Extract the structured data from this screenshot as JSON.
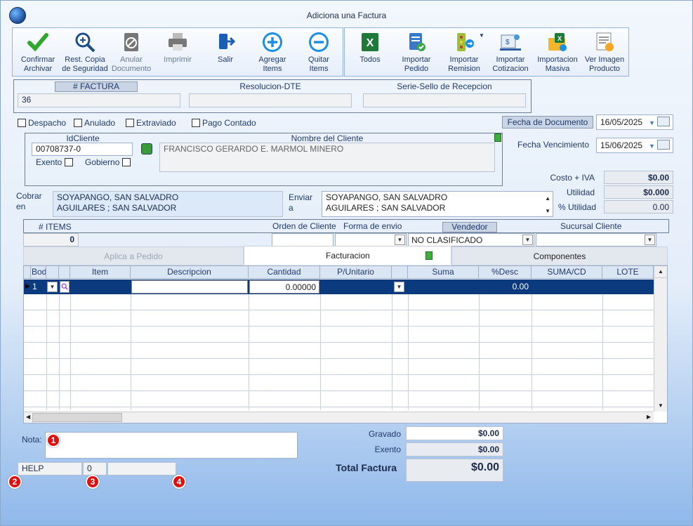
{
  "window": {
    "title": "Adiciona una Factura"
  },
  "toolbar": {
    "left": [
      {
        "label1": "Confirmar",
        "label2": "Archivar"
      },
      {
        "label1": "Rest. Copia",
        "label2": "de Seguridad"
      },
      {
        "label1": "Anular",
        "label2": "Documento"
      },
      {
        "label1": "Imprimir",
        "label2": ""
      },
      {
        "label1": "Salir",
        "label2": ""
      },
      {
        "label1": "Agregar",
        "label2": "Items"
      },
      {
        "label1": "Quitar",
        "label2": "Items"
      }
    ],
    "right": [
      {
        "label1": "Todos",
        "label2": ""
      },
      {
        "label1": "Importar",
        "label2": "Pedido"
      },
      {
        "label1": "Importar",
        "label2": "Remision"
      },
      {
        "label1": "Importar",
        "label2": "Cotizacion"
      },
      {
        "label1": "Importacion",
        "label2": "Masiva"
      },
      {
        "label1": "Ver Imagen",
        "label2": "Producto"
      }
    ]
  },
  "header": {
    "factura_label": "# FACTURA",
    "factura_value": "36",
    "resolucion_label": "Resolucion-DTE",
    "resolucion_value": "",
    "serie_label": "Serie-Sello de Recepcion",
    "serie_value": ""
  },
  "flags": {
    "despacho": "Despacho",
    "anulado": "Anulado",
    "extraviado": "Extraviado",
    "pago_contado": "Pago Contado"
  },
  "dates": {
    "fecha_doc_label": "Fecha de  Documento",
    "fecha_doc": "16/05/2025",
    "venc_label": "Fecha Vencimiento",
    "venc": "15/06/2025"
  },
  "cliente": {
    "id_label": "IdCliente",
    "id_value": "00708737-0",
    "nombre_label": "Nombre del Cliente",
    "nombre_value": "FRANCISCO GERARDO E. MARMOL MINERO",
    "exento": "Exento",
    "gobierno": "Gobierno"
  },
  "totales_side": {
    "costo_label": "Costo + IVA",
    "costo": "$0.00",
    "util_label": "Utilidad",
    "util": "$0.000",
    "putil_label": "% Utilidad",
    "putil": "0.00"
  },
  "direcciones": {
    "cobrar_label1": "Cobrar",
    "cobrar_label2": "en",
    "cobrar_l1": "SOYAPANGO, SAN SALVADRO",
    "cobrar_l2": "AGUILARES ; SAN SALVADOR",
    "enviar_label1": "Enviar",
    "enviar_label2": "a",
    "enviar_l1": "SOYAPANGO, SAN SALVADRO",
    "enviar_l2": "AGUILARES ; SAN SALVADOR"
  },
  "info": {
    "items_label": "# ITEMS",
    "items_value": "0",
    "orden_label": "Orden de Cliente",
    "forma_label": "Forma de envio",
    "vendedor_label": "Vendedor",
    "vendedor_value": "NO CLASIFICADO",
    "sucursal_label": "Sucursal Cliente"
  },
  "tabs": {
    "t1": "Aplica a Pedido",
    "t2": "Facturacion",
    "t3": "Componentes"
  },
  "grid": {
    "cols": [
      "Bodega",
      "",
      "Item",
      "Descripcion",
      "Cantidad",
      "P/Unitario",
      "",
      "Suma",
      "%Desc",
      "SUMA/CD",
      "LOTE"
    ],
    "row": {
      "bodega": "1",
      "cantidad": "0.00000",
      "desc": "0.00"
    }
  },
  "nota": {
    "label": "Nota:"
  },
  "status": {
    "help": "HELP",
    "count": "0",
    "extra": ""
  },
  "badges": [
    "1",
    "2",
    "3",
    "4"
  ],
  "totales": {
    "gravado_label": "Gravado",
    "gravado": "$0.00",
    "exento_label": "Exento",
    "exento": "$0.00",
    "total_label": "Total Factura",
    "total": "$0.00"
  }
}
